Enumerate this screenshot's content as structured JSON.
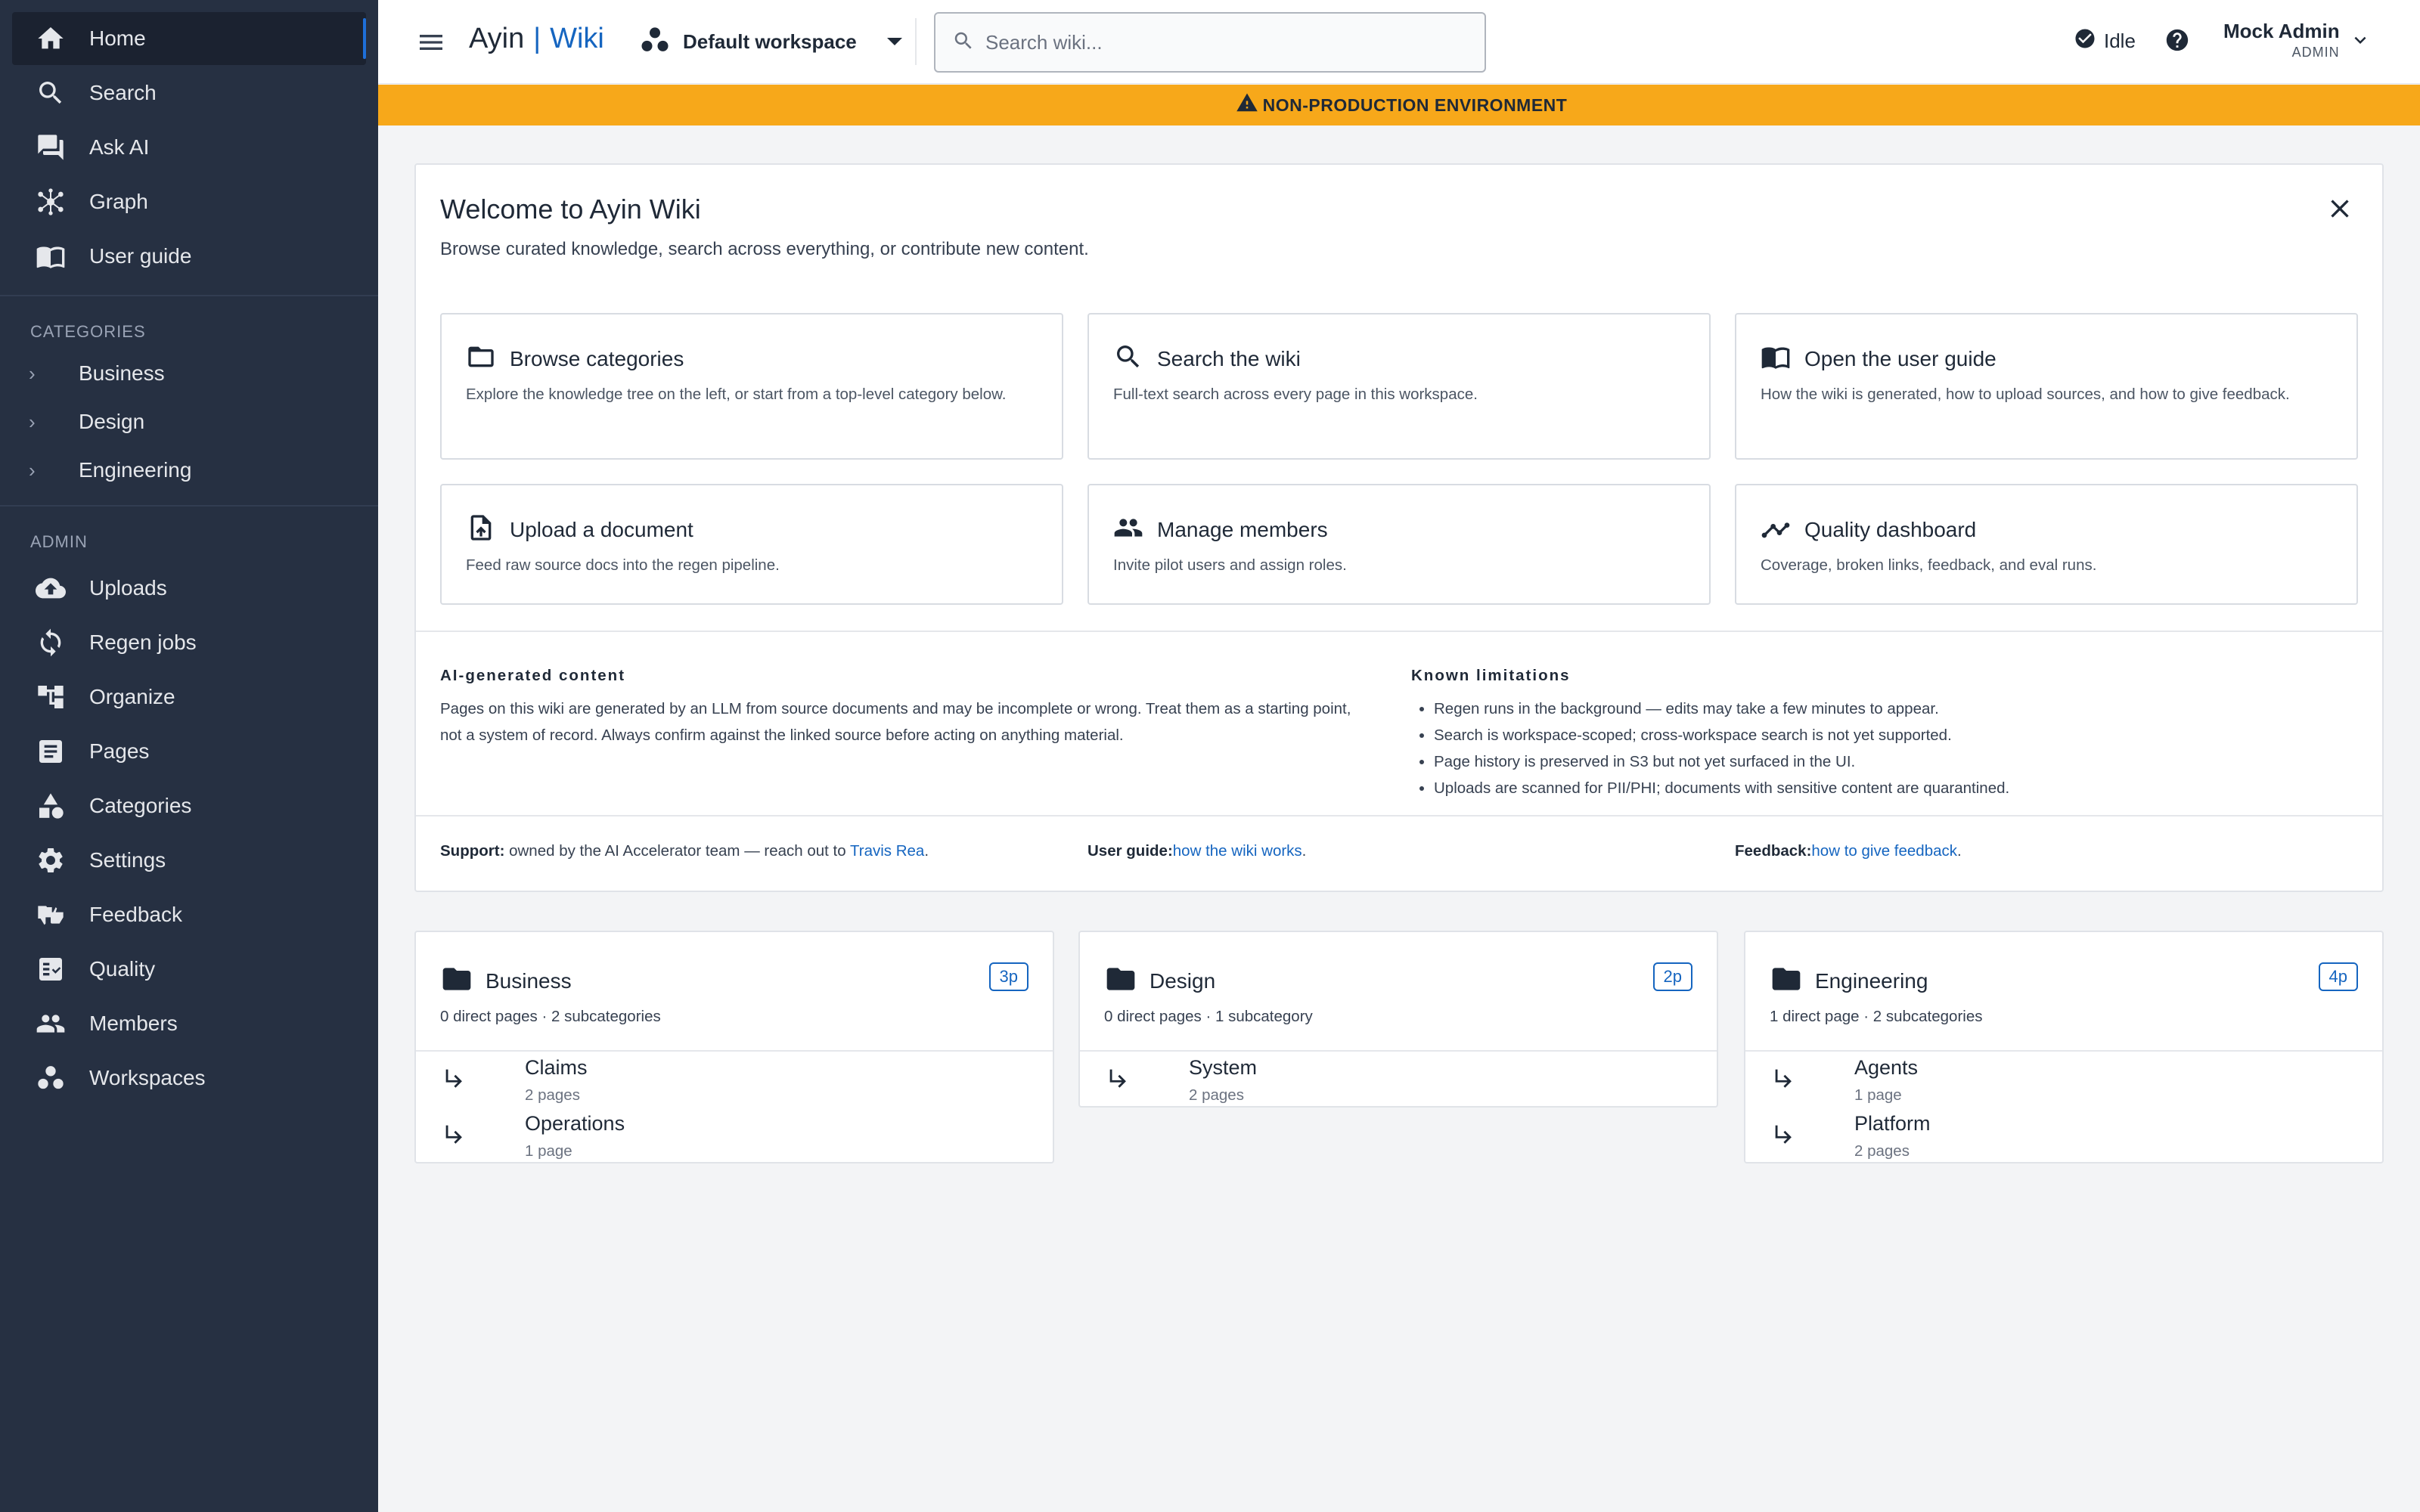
{
  "sidebar": {
    "nav": [
      {
        "label": "Home",
        "icon": "home-icon",
        "active": true
      },
      {
        "label": "Search",
        "icon": "search-icon"
      },
      {
        "label": "Ask AI",
        "icon": "chat-icon"
      },
      {
        "label": "Graph",
        "icon": "graph-icon"
      },
      {
        "label": "User guide",
        "icon": "book-icon"
      }
    ],
    "categories_title": "CATEGORIES",
    "categories": [
      {
        "label": "Business"
      },
      {
        "label": "Design"
      },
      {
        "label": "Engineering"
      }
    ],
    "admin_title": "ADMIN",
    "admin": [
      {
        "label": "Uploads",
        "icon": "cloud-upload-icon"
      },
      {
        "label": "Regen jobs",
        "icon": "sync-icon"
      },
      {
        "label": "Organize",
        "icon": "tree-icon"
      },
      {
        "label": "Pages",
        "icon": "article-icon"
      },
      {
        "label": "Categories",
        "icon": "category-icon"
      },
      {
        "label": "Settings",
        "icon": "gear-icon"
      },
      {
        "label": "Feedback",
        "icon": "thumbs-icon"
      },
      {
        "label": "Quality",
        "icon": "checklist-icon"
      },
      {
        "label": "Members",
        "icon": "people-icon"
      },
      {
        "label": "Workspaces",
        "icon": "workspaces-icon"
      }
    ]
  },
  "header": {
    "brand_name": "Ayin",
    "brand_sep": "|",
    "brand_product": "Wiki",
    "workspace": "Default workspace",
    "search_placeholder": "Search wiki...",
    "status": "Idle",
    "user_name": "Mock Admin",
    "user_role": "ADMIN"
  },
  "banner": {
    "text": "NON-PRODUCTION ENVIRONMENT",
    "color": "#f7a81a"
  },
  "welcome": {
    "title": "Welcome to Ayin Wiki",
    "subtitle": "Browse curated knowledge, search across everything, or contribute new content.",
    "cards": [
      {
        "title": "Browse categories",
        "desc": "Explore the knowledge tree on the left, or start from a top-level category below.",
        "icon": "folder-outline-icon"
      },
      {
        "title": "Search the wiki",
        "desc": "Full-text search across every page in this workspace.",
        "icon": "search-icon"
      },
      {
        "title": "Open the user guide",
        "desc": "How the wiki is generated, how to upload sources, and how to give feedback.",
        "icon": "book-icon"
      },
      {
        "title": "Upload a document",
        "desc": "Feed raw source docs into the regen pipeline.",
        "icon": "file-upload-icon"
      },
      {
        "title": "Manage members",
        "desc": "Invite pilot users and assign roles.",
        "icon": "people-icon"
      },
      {
        "title": "Quality dashboard",
        "desc": "Coverage, broken links, feedback, and eval runs.",
        "icon": "insights-icon"
      }
    ],
    "ai_heading": "AI-generated content",
    "ai_text": "Pages on this wiki are generated by an LLM from source documents and may be incomplete or wrong. Treat them as a starting point, not a system of record. Always confirm against the linked source before acting on anything material.",
    "limits_heading": "Known limitations",
    "limits": [
      "Regen runs in the background — edits may take a few minutes to appear.",
      "Search is workspace-scoped; cross-workspace search is not yet supported.",
      "Page history is preserved in S3 but not yet surfaced in the UI.",
      "Uploads are scanned for PII/PHI; documents with sensitive content are quarantined."
    ],
    "footer": {
      "support_label": "Support:",
      "support_text": " owned by the AI Accelerator team — reach out to ",
      "support_link": "Travis Rea",
      "support_end": ".",
      "guide_label": "User guide:",
      "guide_link": "how the wiki works",
      "guide_end": ".",
      "feedback_label": "Feedback:",
      "feedback_link": "how to give feedback",
      "feedback_end": "."
    }
  },
  "category_cards": [
    {
      "name": "Business",
      "badge": "3p",
      "meta": "0 direct pages · 2 subcategories",
      "subs": [
        {
          "name": "Claims",
          "count": "2 pages"
        },
        {
          "name": "Operations",
          "count": "1 page"
        }
      ]
    },
    {
      "name": "Design",
      "badge": "2p",
      "meta": "0 direct pages · 1 subcategory",
      "subs": [
        {
          "name": "System",
          "count": "2 pages"
        }
      ]
    },
    {
      "name": "Engineering",
      "badge": "4p",
      "meta": "1 direct page · 2 subcategories",
      "subs": [
        {
          "name": "Agents",
          "count": "1 page"
        },
        {
          "name": "Platform",
          "count": "2 pages"
        }
      ]
    }
  ]
}
